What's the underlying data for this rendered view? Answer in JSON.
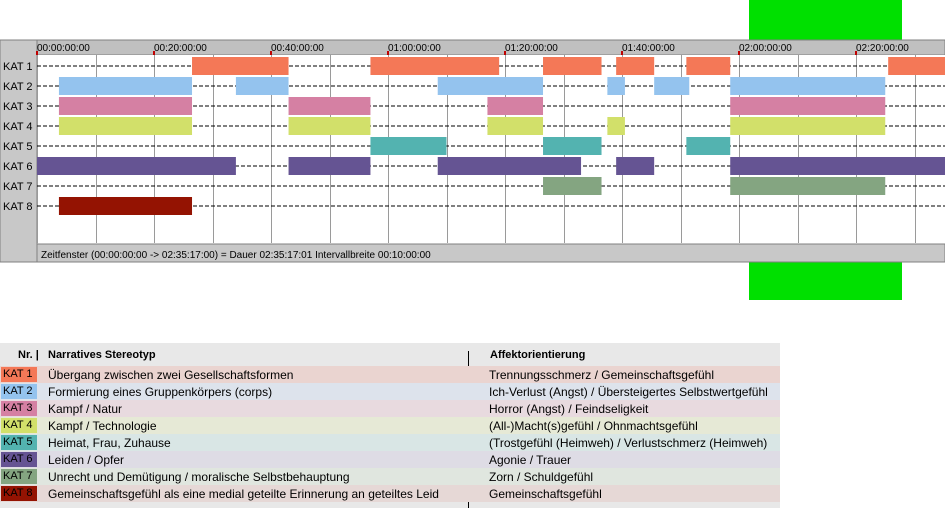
{
  "chart_data": {
    "type": "timeline",
    "time_axis": {
      "start": "00:00:00:00",
      "end": "02:35:17:00",
      "tick_labels": [
        "00:00:00:00",
        "00:20:00:00",
        "00:40:00:00",
        "01:00:00:00",
        "01:20:00:00",
        "01:40:00:00",
        "02:00:00:00",
        "02:20:00:00"
      ],
      "gridline_interval_minutes": 10
    },
    "status_text": "Zeitfenster (00:00:00:00 -> 02:35:17:00) = Dauer 02:35:17:01    Intervallbreite 00:10:00:00",
    "series": [
      {
        "name": "KAT 1",
        "color": "#f47857",
        "intervals": [
          [
            "00:26:30",
            "00:43:00"
          ],
          [
            "00:57:00",
            "01:19:00"
          ],
          [
            "01:26:30",
            "01:36:30"
          ],
          [
            "01:39:00",
            "01:45:30"
          ],
          [
            "01:51:00",
            "01:58:30"
          ],
          [
            "02:25:30",
            "02:35:17"
          ]
        ]
      },
      {
        "name": "KAT 2",
        "color": "#94c3ee",
        "intervals": [
          [
            "00:03:45",
            "00:26:30"
          ],
          [
            "00:34:00",
            "00:43:00"
          ],
          [
            "01:08:30",
            "01:26:30"
          ],
          [
            "01:37:30",
            "01:40:30"
          ],
          [
            "01:45:30",
            "01:51:30"
          ],
          [
            "01:58:30",
            "02:25:00"
          ]
        ]
      },
      {
        "name": "KAT 3",
        "color": "#d580a3",
        "intervals": [
          [
            "00:03:45",
            "00:26:30"
          ],
          [
            "00:43:00",
            "00:57:00"
          ],
          [
            "01:17:00",
            "01:26:30"
          ],
          [
            "01:58:30",
            "02:25:00"
          ]
        ]
      },
      {
        "name": "KAT 4",
        "color": "#d2e06a",
        "intervals": [
          [
            "00:03:45",
            "00:26:30"
          ],
          [
            "00:43:00",
            "00:57:00"
          ],
          [
            "01:17:00",
            "01:26:30"
          ],
          [
            "01:37:30",
            "01:40:30"
          ],
          [
            "01:58:30",
            "02:25:00"
          ]
        ]
      },
      {
        "name": "KAT 5",
        "color": "#53b3b0",
        "intervals": [
          [
            "00:57:00",
            "01:10:00"
          ],
          [
            "01:26:30",
            "01:36:30"
          ],
          [
            "01:51:00",
            "01:58:30"
          ]
        ]
      },
      {
        "name": "KAT 6",
        "color": "#655493",
        "intervals": [
          [
            "00:00:00",
            "00:34:00"
          ],
          [
            "00:43:00",
            "00:57:00"
          ],
          [
            "01:08:30",
            "01:33:00"
          ],
          [
            "01:39:00",
            "01:45:30"
          ],
          [
            "01:58:30",
            "02:35:17"
          ]
        ]
      },
      {
        "name": "KAT 7",
        "color": "#84a581",
        "intervals": [
          [
            "01:26:30",
            "01:36:30"
          ],
          [
            "01:58:30",
            "02:25:00"
          ]
        ]
      },
      {
        "name": "KAT 8",
        "color": "#941302",
        "intervals": [
          [
            "00:03:45",
            "00:26:30"
          ]
        ]
      }
    ]
  },
  "legend": {
    "headers": {
      "nr": "Nr. |",
      "stereotype": "Narratives Stereotyp",
      "affekt": "Affektorientierung"
    },
    "rows": [
      {
        "kat": "KAT 1",
        "color": "#f47857",
        "stereotype": "Übergang zwischen zwei Gesellschaftsformen",
        "affekt": "Trennungsschmerz / Gemeinschaftsgefühl",
        "row_bg": "#ead4d0"
      },
      {
        "kat": "KAT 2",
        "color": "#94c3ee",
        "stereotype": "Formierung eines Gruppenkörpers (corps)",
        "affekt": "Ich-Verlust (Angst) / Übersteigertes Selbstwertgefühl",
        "row_bg": "#dde3ec"
      },
      {
        "kat": "KAT 3",
        "color": "#d580a3",
        "stereotype": "Kampf / Natur",
        "affekt": "Horror (Angst) / Feindseligkeit",
        "row_bg": "#e8dadf"
      },
      {
        "kat": "KAT 4",
        "color": "#d2e06a",
        "stereotype": "Kampf / Technologie",
        "affekt": "(All-)Macht(s)gefühl / Ohnmachtsgefühl",
        "row_bg": "#e6e9d6"
      },
      {
        "kat": "KAT 5",
        "color": "#53b3b0",
        "stereotype": "Heimat, Frau, Zuhause",
        "affekt": "(Trostgefühl (Heimweh) / Verlustschmerz (Heimweh)",
        "row_bg": "#d9e6e5"
      },
      {
        "kat": "KAT 6",
        "color": "#655493",
        "stereotype": "Leiden / Opfer",
        "affekt": "Agonie / Trauer",
        "row_bg": "#dedce5"
      },
      {
        "kat": "KAT 7",
        "color": "#84a581",
        "stereotype": "Unrecht und Demütigung / moralische Selbstbehauptung",
        "affekt": "Zorn / Schuldgefühl",
        "row_bg": "#e0e6df"
      },
      {
        "kat": "KAT 8",
        "color": "#941302",
        "stereotype": "Gemeinschaftsgefühl als eine medial geteilte Erinnerung an geteiltes Leid",
        "affekt": "Gemeinschaftsgefühl",
        "row_bg": "#e6d8d6"
      }
    ]
  }
}
